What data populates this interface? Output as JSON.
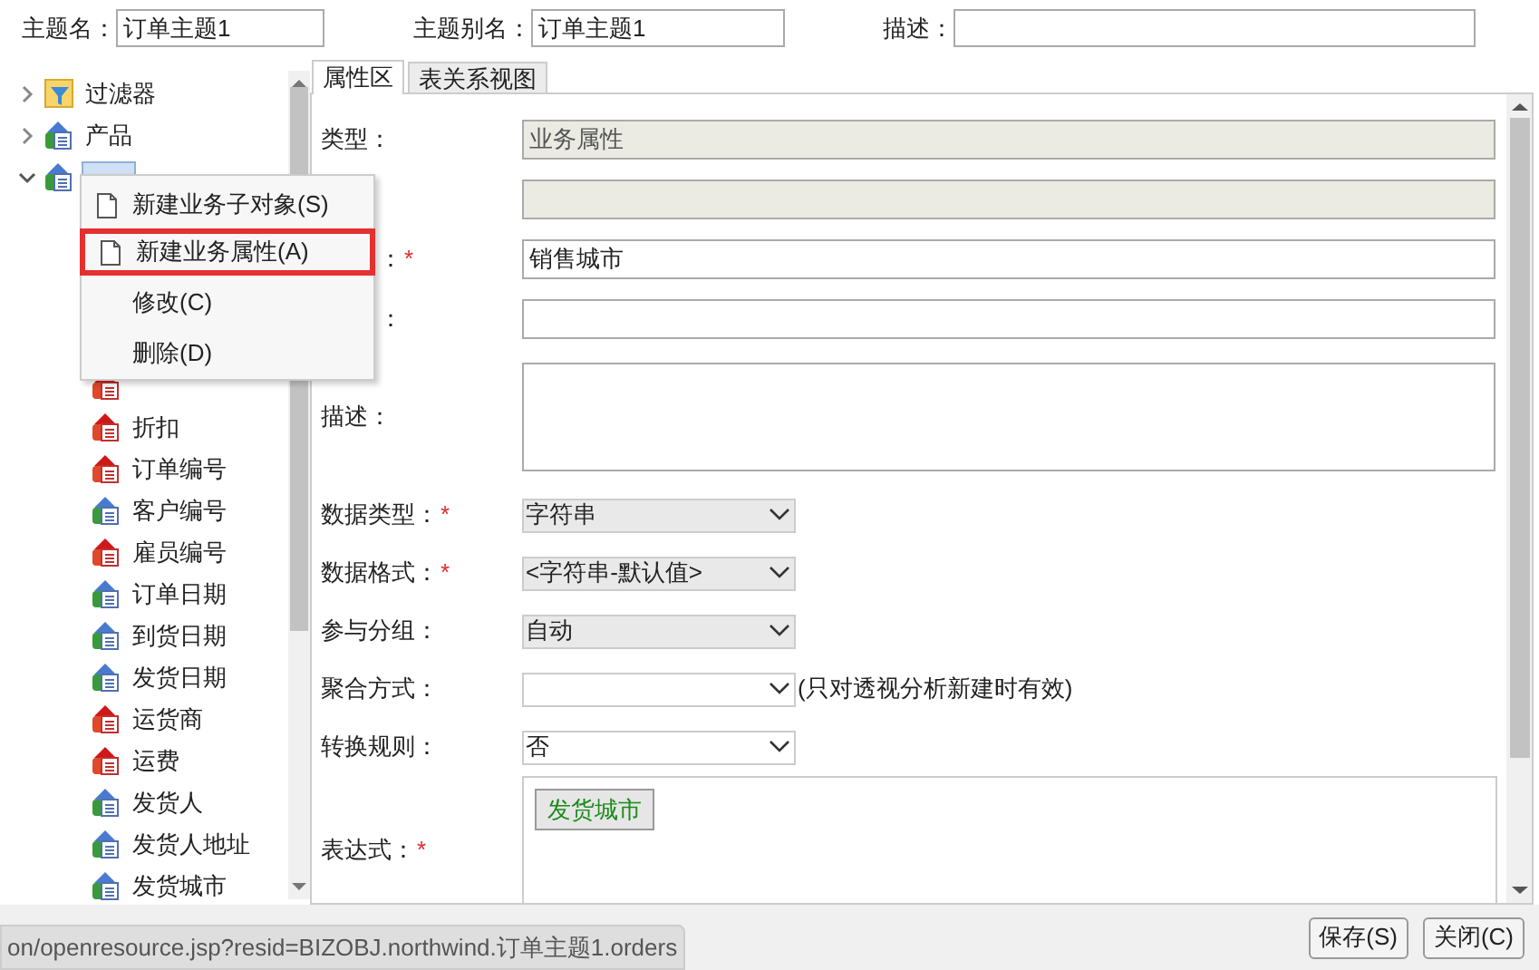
{
  "header": {
    "fields": [
      {
        "label": "主题名：",
        "value": "订单主题1"
      },
      {
        "label": "主题别名：",
        "value": "订单主题1"
      },
      {
        "label": "描述："
      }
    ]
  },
  "tree": {
    "items": [
      {
        "label": "过滤器",
        "kind": "filter",
        "expanded": false,
        "selected": false
      },
      {
        "label": "产品",
        "kind": "object",
        "expanded": false,
        "selected": false
      },
      {
        "kind": "object",
        "expanded": true,
        "selected": true,
        "children": [
          {
            "kind": "measure"
          },
          {
            "label": "折扣",
            "kind": "measure"
          },
          {
            "label": "订单编号",
            "kind": "measure"
          },
          {
            "label": "客户编号",
            "kind": "dimension"
          },
          {
            "label": "雇员编号",
            "kind": "measure"
          },
          {
            "label": "订单日期",
            "kind": "dimension"
          },
          {
            "label": "到货日期",
            "kind": "dimension"
          },
          {
            "label": "发货日期",
            "kind": "dimension"
          },
          {
            "label": "运货商",
            "kind": "measure"
          },
          {
            "label": "运费",
            "kind": "measure"
          },
          {
            "label": "发货人",
            "kind": "dimension"
          },
          {
            "label": "发货人地址",
            "kind": "dimension"
          },
          {
            "label": "发货城市",
            "kind": "dimension"
          }
        ]
      }
    ]
  },
  "context_menu": {
    "items": [
      {
        "label": "新建业务子对象(S)",
        "icon": true,
        "selected": false
      },
      {
        "label": "新建业务属性(A)",
        "icon": true,
        "selected": true
      },
      {
        "label": "修改(C)",
        "icon": false,
        "selected": false
      },
      {
        "label": "删除(D)",
        "icon": false,
        "selected": false
      }
    ]
  },
  "tabs": [
    {
      "label": "属性区",
      "selected": true
    },
    {
      "label": "表关系视图",
      "selected": false
    }
  ],
  "form": {
    "rows": [
      {
        "kind": "text",
        "label": "类型：",
        "value": "业务属性",
        "disabled": true
      },
      {
        "kind": "text",
        "disabled": true
      },
      {
        "kind": "text",
        "label_tail": "：",
        "required_mark": "*",
        "value": "销售城市",
        "disabled": false
      },
      {
        "kind": "text",
        "label_tail": "：",
        "disabled": false
      },
      {
        "kind": "textarea",
        "label": "描述：",
        "disabled": false
      },
      {
        "kind": "select",
        "label": "数据类型：",
        "required_mark": "*",
        "value": "字符串",
        "disabled": true
      },
      {
        "kind": "select",
        "label": "数据格式：",
        "required_mark": "*",
        "value": "<字符串-默认值>",
        "disabled": true
      },
      {
        "kind": "select",
        "label": "参与分组：",
        "value": "自动",
        "disabled": true
      },
      {
        "kind": "select",
        "label": "聚合方式：",
        "disabled": false,
        "note": "(只对透视分析新建时有效)"
      },
      {
        "kind": "select",
        "label": "转换规则：",
        "value": "否",
        "disabled": false
      },
      {
        "kind": "expression",
        "label": "表达式：",
        "required_mark": "*",
        "tokens": [
          "发货城市"
        ]
      }
    ]
  },
  "status_bar": {
    "url": "on/openresource.jsp?resid=BIZOBJ.northwind.订单主题1.orders"
  },
  "buttons": [
    {
      "label": "保存(S)"
    },
    {
      "label": "关闭(C)"
    }
  ]
}
